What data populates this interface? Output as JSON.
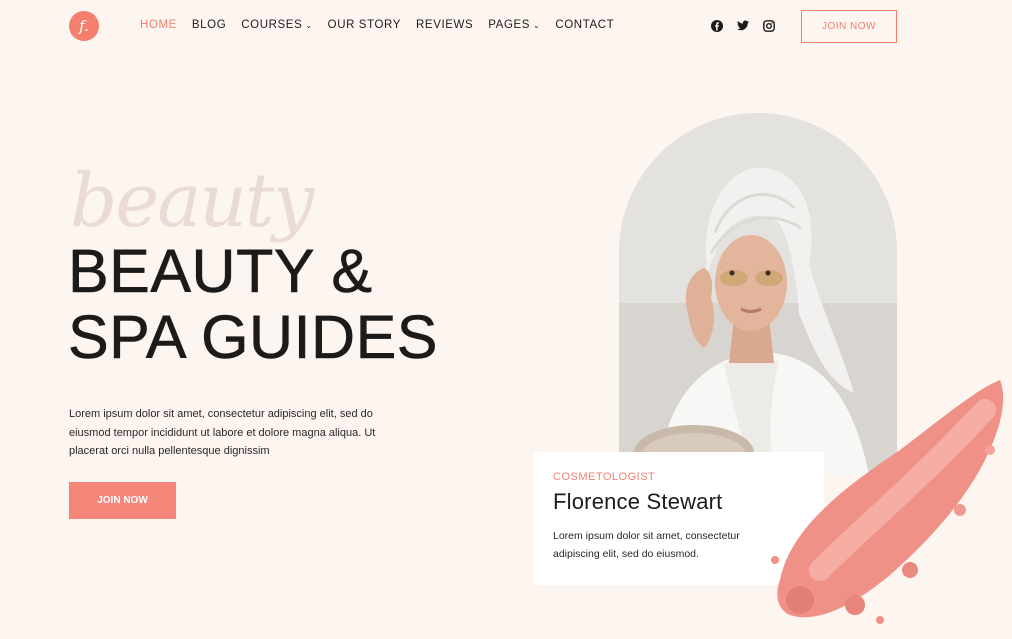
{
  "brand": {
    "logo_letter": "f."
  },
  "nav": {
    "items": [
      {
        "label": "HOME",
        "active": true,
        "dropdown": false
      },
      {
        "label": "BLOG",
        "active": false,
        "dropdown": false
      },
      {
        "label": "COURSES",
        "active": false,
        "dropdown": true
      },
      {
        "label": "OUR STORY",
        "active": false,
        "dropdown": false
      },
      {
        "label": "REVIEWS",
        "active": false,
        "dropdown": false
      },
      {
        "label": "PAGES",
        "active": false,
        "dropdown": true
      },
      {
        "label": "CONTACT",
        "active": false,
        "dropdown": false
      }
    ]
  },
  "social": [
    "facebook-icon",
    "twitter-icon",
    "instagram-icon"
  ],
  "header_cta": "JOIN NOW",
  "hero": {
    "script_word": "beauty",
    "title_line1": "BEAUTY &",
    "title_line2": "SPA GUIDES",
    "intro": "Lorem ipsum dolor sit amet, consectetur adipiscing elit, sed do eiusmod tempor incididunt ut labore et dolore magna aliqua. Ut placerat orci nulla pellentesque dignissim",
    "cta": "JOIN NOW"
  },
  "profile": {
    "role": "COSMETOLOGIST",
    "name": "Florence Stewart",
    "bio": "Lorem ipsum dolor sit amet, consectetur adipiscing elit, sed do eiusmod."
  },
  "colors": {
    "accent": "#f47f6f",
    "background": "#fdf5f0",
    "button": "#f4877a"
  }
}
